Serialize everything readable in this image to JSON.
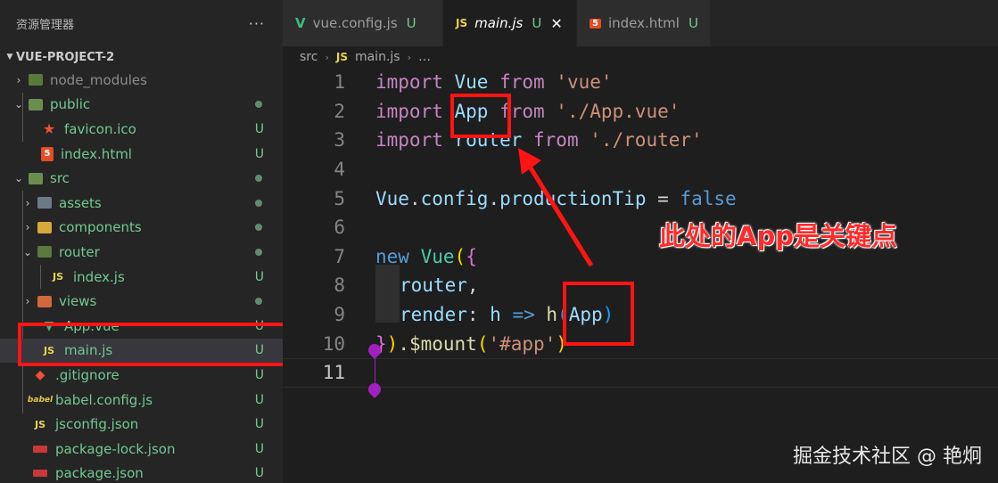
{
  "sidebar": {
    "title": "资源管理器",
    "more": "···",
    "project": "VUE-PROJECT-2",
    "items": [
      {
        "label": "node_modules",
        "status": ""
      },
      {
        "label": "public",
        "status": ""
      },
      {
        "label": "favicon.ico",
        "status": "U"
      },
      {
        "label": "index.html",
        "status": "U"
      },
      {
        "label": "src",
        "status": ""
      },
      {
        "label": "assets",
        "status": ""
      },
      {
        "label": "components",
        "status": ""
      },
      {
        "label": "router",
        "status": ""
      },
      {
        "label": "index.js",
        "status": "U"
      },
      {
        "label": "views",
        "status": ""
      },
      {
        "label": "App.vue",
        "status": "U"
      },
      {
        "label": "main.js",
        "status": "U"
      },
      {
        "label": ".gitignore",
        "status": "U"
      },
      {
        "label": "babel.config.js",
        "status": "U"
      },
      {
        "label": "jsconfig.json",
        "status": "U"
      },
      {
        "label": "package-lock.json",
        "status": "U"
      },
      {
        "label": "package.json",
        "status": "U"
      }
    ]
  },
  "tabs": [
    {
      "label": "vue.config.js",
      "status": "U"
    },
    {
      "label": "main.js",
      "status": "U"
    },
    {
      "label": "index.html",
      "status": "U"
    }
  ],
  "icons": {
    "js": "JS",
    "html": "5"
  },
  "breadcrumb": {
    "folder": "src",
    "file": "main.js",
    "rest": "…"
  },
  "line_numbers": [
    "1",
    "2",
    "3",
    "4",
    "5",
    "6",
    "7",
    "8",
    "9",
    "10",
    "11"
  ],
  "code": {
    "l1": [
      "import",
      " Vue ",
      "from",
      " 'vue'"
    ],
    "l2": [
      "import",
      " App ",
      "from",
      " './App.vue'"
    ],
    "l3": [
      "import",
      " router ",
      "from",
      " './router'"
    ],
    "l5": [
      "Vue",
      ".",
      "config",
      ".",
      "productionTip",
      " = ",
      "false"
    ],
    "l7": [
      "new",
      " ",
      "Vue",
      "(",
      "{"
    ],
    "l8": [
      "router",
      ","
    ],
    "l9": [
      "render",
      ": ",
      "h",
      " => ",
      "h",
      "(",
      "App",
      ")"
    ],
    "l10": [
      "}",
      ")",
      ".",
      "$mount",
      "(",
      "'#app'",
      ")"
    ]
  },
  "annotation": "此处的App是关键点",
  "watermark": "掘金技术社区 @ 艳炯",
  "colors": {
    "highlight": "#ff1414",
    "untracked": "#73c991"
  }
}
